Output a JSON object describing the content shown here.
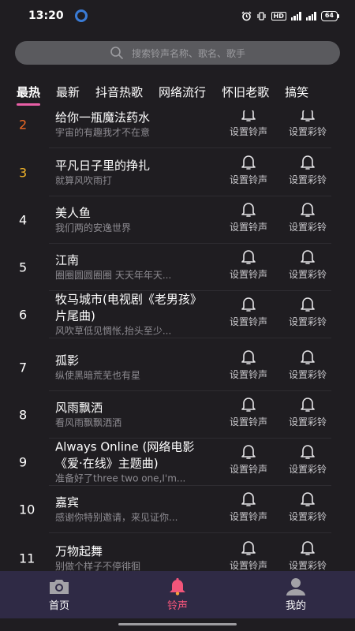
{
  "status": {
    "time": "13:20",
    "hd": "HD",
    "battery": "64"
  },
  "search": {
    "placeholder": "搜索铃声名称、歌名、歌手"
  },
  "tabs": [
    "最热",
    "最新",
    "抖音热歌",
    "网络流行",
    "怀旧老歌",
    "搞笑"
  ],
  "active_tab": 0,
  "actions": {
    "set_ringtone": "设置铃声",
    "set_color_ring": "设置彩铃"
  },
  "songs": [
    {
      "rank": "2",
      "title": "给你一瓶魔法药水",
      "subtitle": "宇宙的有趣我才不在意"
    },
    {
      "rank": "3",
      "title": "平凡日子里的挣扎",
      "subtitle": "就算风吹雨打"
    },
    {
      "rank": "4",
      "title": "美人鱼",
      "subtitle": "我们两的安逸世界"
    },
    {
      "rank": "5",
      "title": "江南",
      "subtitle": "圈圈圆圆圈圈 天天年年天..."
    },
    {
      "rank": "6",
      "title": "牧马城市(电视剧《老男孩》片尾曲)",
      "subtitle": "风吹草低见惆怅,抬头至少..."
    },
    {
      "rank": "7",
      "title": "孤影",
      "subtitle": "纵使黑暗荒芜也有星"
    },
    {
      "rank": "8",
      "title": "风雨飘洒",
      "subtitle": "看风雨飘飘洒洒"
    },
    {
      "rank": "9",
      "title": "Always Online (网络电影《爱·在线》主题曲)",
      "subtitle": "准备好了three two one,I'm..."
    },
    {
      "rank": "10",
      "title": "嘉宾",
      "subtitle": "感谢你特别邀请，来见证你..."
    },
    {
      "rank": "11",
      "title": "万物起舞",
      "subtitle": "别做个样子不停徘徊"
    }
  ],
  "nav": {
    "items": [
      "首页",
      "铃声",
      "我的"
    ],
    "active": 1
  },
  "colors": {
    "background": "#1f1d21",
    "accent_pink": "#e85fa6",
    "rank_top": "#f06a25",
    "rank_third": "#f3b52a",
    "nav_background": "#2f2a45",
    "nav_active": "#f2557a"
  },
  "icons": {
    "status_app": "qq-browser-icon",
    "search": "search-icon",
    "action": "bell-icon",
    "nav_home": "camera-icon",
    "nav_ringtone": "bell-icon",
    "nav_profile": "user-icon"
  }
}
